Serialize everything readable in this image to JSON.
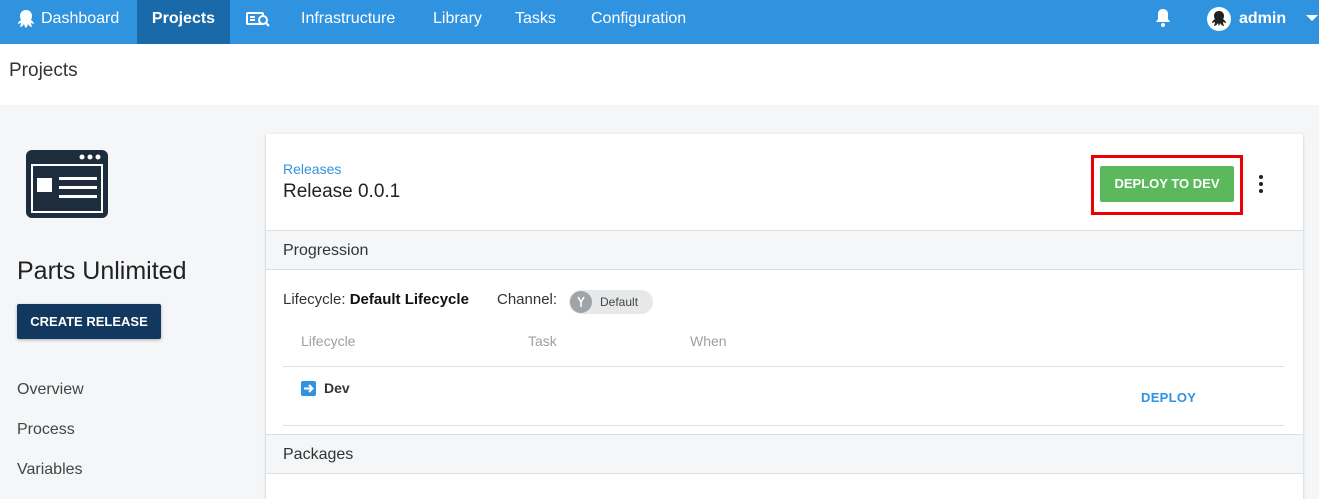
{
  "nav": {
    "dashboard": "Dashboard",
    "projects": "Projects",
    "infrastructure": "Infrastructure",
    "library": "Library",
    "tasks": "Tasks",
    "configuration": "Configuration",
    "user": "admin",
    "icons": [
      "octopus-icon",
      "infrastructure-icon",
      "bell-icon",
      "avatar",
      "caret-down-icon"
    ]
  },
  "header": {
    "title": "Projects"
  },
  "sidebar": {
    "project_name": "Parts Unlimited",
    "create_release": "CREATE RELEASE",
    "links": [
      "Overview",
      "Process",
      "Variables"
    ]
  },
  "release": {
    "breadcrumb": "Releases",
    "title": "Release 0.0.1",
    "deploy_button": "DEPLOY TO DEV"
  },
  "progression": {
    "heading": "Progression",
    "lifecycle_label": "Lifecycle:",
    "lifecycle_value": "Default Lifecycle",
    "channel_label": "Channel:",
    "channel_value": "Default",
    "columns": [
      "Lifecycle",
      "Task",
      "When"
    ],
    "rows": [
      {
        "environment": "Dev",
        "action": "DEPLOY"
      }
    ]
  },
  "packages": {
    "heading": "Packages"
  },
  "colors": {
    "nav_bg": "#2f93e0",
    "nav_active": "#1a6aaa",
    "deploy_green": "#5cb85c",
    "create_navy": "#12385f",
    "highlight_red": "#ee0000"
  }
}
